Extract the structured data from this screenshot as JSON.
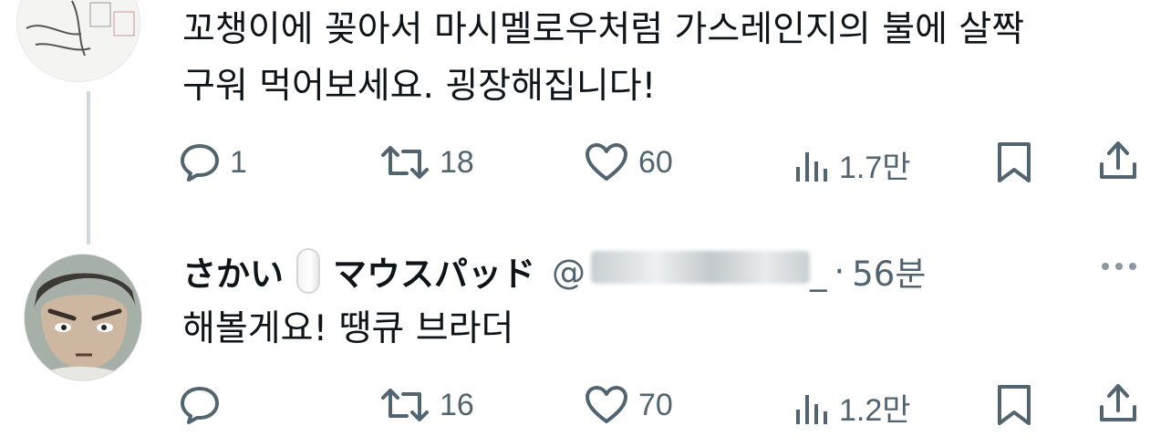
{
  "tweet1": {
    "text_line1": "꼬챙이에 꽂아서 마시멜로우처럼 가스레인지의 불에 살짝",
    "text_line2": "구워 먹어보세요. 굉장해집니다!",
    "actions": {
      "replies": "1",
      "reposts": "18",
      "likes": "60",
      "views": "1.7만"
    }
  },
  "tweet2": {
    "name": "さかい",
    "name_suffix": "マウスパッド",
    "handle_prefix": "@",
    "handle_tail": "_",
    "separator": "·",
    "time": "56분",
    "text": "해볼게요! 땡큐 브라더",
    "actions": {
      "replies": "",
      "reposts": "16",
      "likes": "70",
      "views": "1.2만"
    }
  },
  "icons": {
    "reply": "reply-icon",
    "repost": "repost-icon",
    "like": "heart-icon",
    "views": "views-icon",
    "bookmark": "bookmark-icon",
    "share": "share-icon",
    "more": "more-icon"
  },
  "colors": {
    "text": "#0f1419",
    "secondary": "#536471",
    "thread_line": "#cfd9de"
  }
}
